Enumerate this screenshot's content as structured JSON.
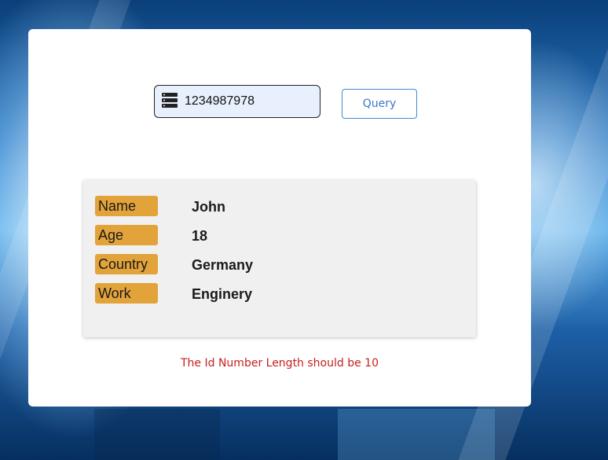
{
  "query": {
    "id_value": "1234987978",
    "icon": "database-server-icon",
    "button_label": "Query"
  },
  "person": {
    "rows": [
      {
        "label": "Name",
        "value": "John"
      },
      {
        "label": "Age",
        "value": "18"
      },
      {
        "label": "Country",
        "value": "Germany"
      },
      {
        "label": "Work",
        "value": "Enginery"
      }
    ]
  },
  "validation": {
    "error_message": "The Id Number Length should be 10"
  },
  "colors": {
    "label_bg": "#e2a33a",
    "error_text": "#c81e1e",
    "button_accent": "#3a78cc",
    "input_bg": "#e8f0fe"
  }
}
